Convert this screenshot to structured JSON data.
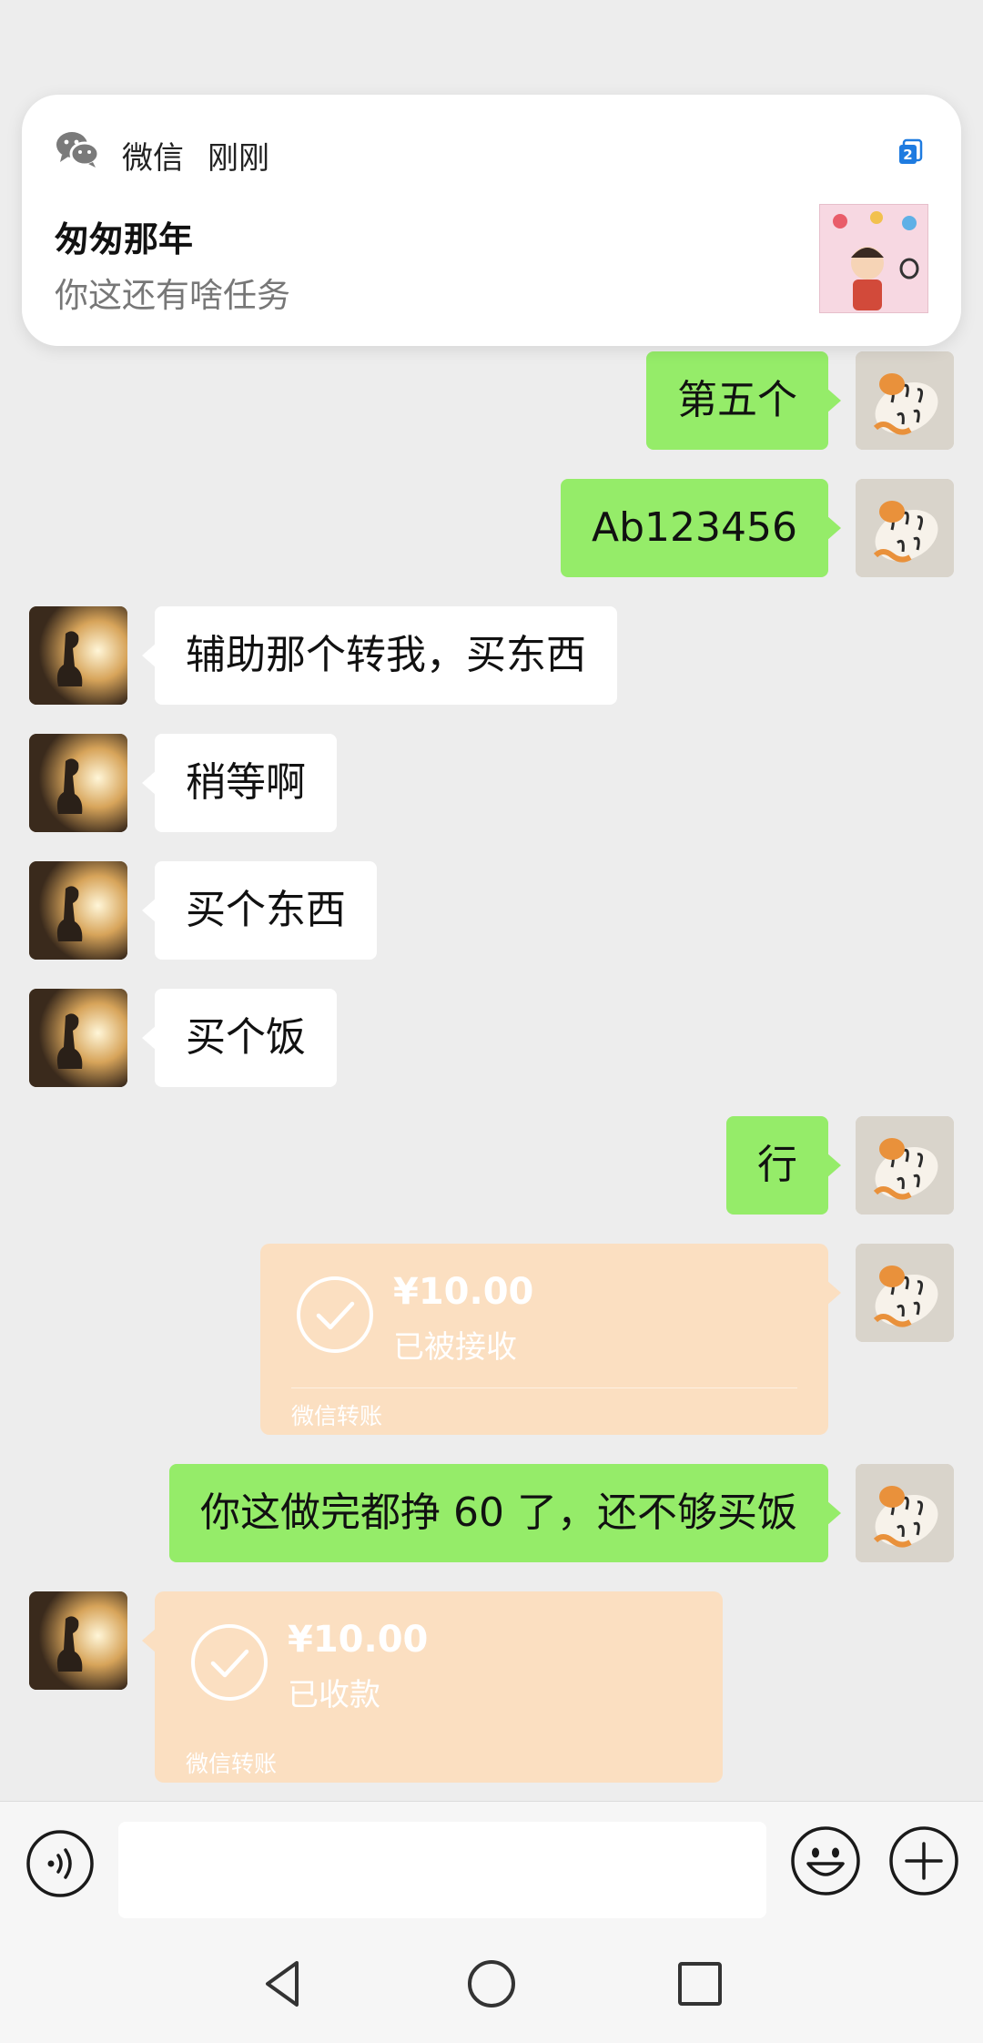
{
  "notification": {
    "app_name": "微信",
    "time": "刚刚",
    "badge": "2",
    "sender": "匆匆那年",
    "message": "你这还有啥任务"
  },
  "messages": [
    {
      "side": "right",
      "type": "text",
      "text": "第五个"
    },
    {
      "side": "right",
      "type": "text",
      "text": "Ab123456"
    },
    {
      "side": "left",
      "type": "text",
      "text": "辅助那个转我，买东西"
    },
    {
      "side": "left",
      "type": "text",
      "text": "稍等啊"
    },
    {
      "side": "left",
      "type": "text",
      "text": "买个东西"
    },
    {
      "side": "left",
      "type": "text",
      "text": "买个饭"
    },
    {
      "side": "right",
      "type": "text",
      "text": "行"
    },
    {
      "side": "right",
      "type": "transfer",
      "amount": "¥10.00",
      "status": "已被接收",
      "footer": "微信转账"
    },
    {
      "side": "right",
      "type": "text",
      "text": "你这做完都挣 60 了，还不够买饭"
    },
    {
      "side": "left",
      "type": "transfer",
      "amount": "¥10.00",
      "status": "已收款",
      "footer": "微信转账"
    }
  ],
  "input": {
    "placeholder": ""
  },
  "colors": {
    "background": "#ededed",
    "bubble_green": "#95ec69",
    "bubble_white": "#ffffff",
    "transfer_done": "#fbdfc1",
    "badge_blue": "#1e7be0"
  },
  "icons": [
    "wechat-icon",
    "app-badge-icon",
    "voice-icon",
    "emoji-icon",
    "plus-icon",
    "back-icon",
    "home-icon",
    "recents-icon",
    "check-circle-icon"
  ]
}
